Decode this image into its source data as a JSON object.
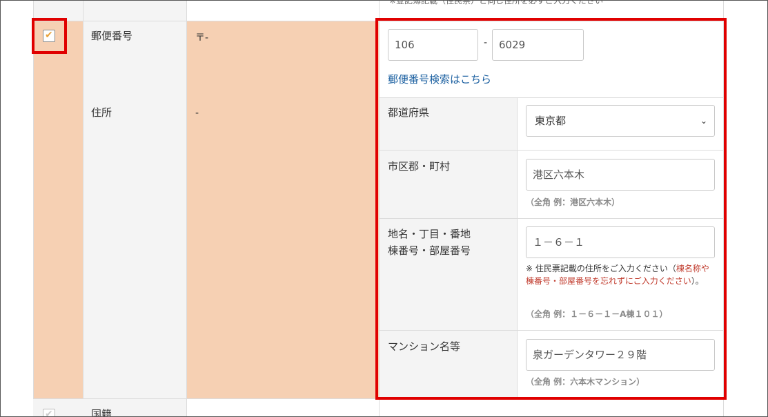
{
  "top_note": "※登記簿記載（住民票）と同じ住所を必ずご入力ください",
  "postal": {
    "label": "郵便番号",
    "current_value": "〒-",
    "field1": "106",
    "separator": "-",
    "field2": "6029",
    "search_link": "郵便番号検索はこちら"
  },
  "address": {
    "label": "住所",
    "current_value": "-",
    "prefecture": {
      "label": "都道府県",
      "selected": "東京都"
    },
    "city": {
      "label": "市区郡・町村",
      "value": "港区六本木",
      "hint": "（全角 例：港区六本木）"
    },
    "street": {
      "label_line1": "地名・丁目・番地",
      "label_line2": "棟番号・部屋番号",
      "value": "１－６－１",
      "note_prefix": "※ 住民票記載の住所をご入力ください（",
      "note_red": "棟名称や棟番号・部屋番号を忘れずにご入力ください",
      "note_suffix": "）。",
      "hint": "（全角 例：１－６－１－A棟１０１）"
    },
    "building": {
      "label": "マンション名等",
      "value": "泉ガーデンタワー２９階",
      "hint": "（全角 例：六本木マンション）"
    }
  },
  "next_row": {
    "label": "国籍"
  },
  "icons": {
    "check": "checkmark-icon",
    "dropdown": "chevron-down-icon"
  },
  "colors": {
    "highlight_row": "#f6d0b3",
    "annotation_border": "#e00000",
    "link": "#1a5fa0",
    "check": "#e8a23c"
  }
}
